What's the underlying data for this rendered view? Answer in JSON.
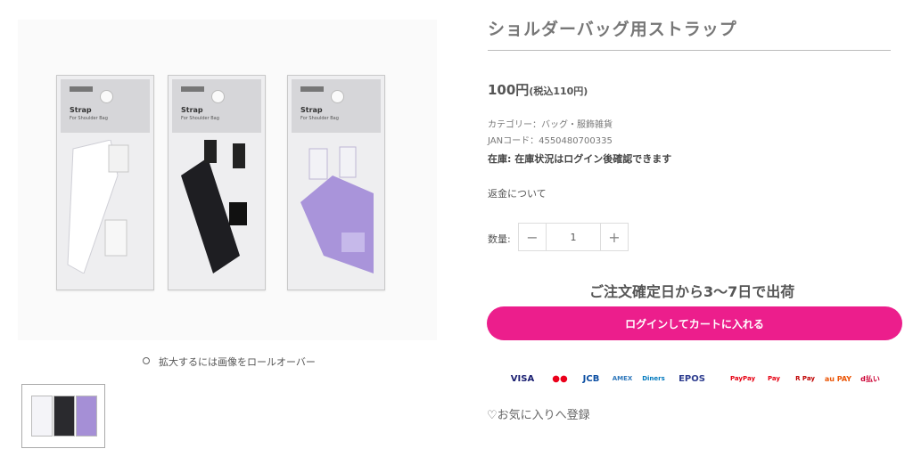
{
  "product": {
    "title": "ショルダーバッグ用ストラップ",
    "price": "100円",
    "price_tax": "(税込110円)",
    "category": "カテゴリー：バッグ・服飾雑貨",
    "jan": "JANコード：4550480700335",
    "stock_label": "在庫:",
    "stock_text": "在庫状況はログイン後確認できます",
    "refund_link": "返金について",
    "qty_label": "数量:",
    "qty_minus": "−",
    "qty_value": "1",
    "qty_plus": "+",
    "shipping_note": "ご注文確定日から3〜7日で出荷",
    "cart_button": "ログインしてカートに入れる",
    "favorite": "お気に入りへ登録"
  },
  "gallery": {
    "zoom_hint": "拡大するには画像をロールオーバー",
    "package_title": "Strap",
    "package_sub": "For Shoulder Bag",
    "variants": [
      {
        "color": "#f4f4f8",
        "strap": "#ffffff",
        "edge": "#cfcfd6"
      },
      {
        "color": "#2a2a2e",
        "strap": "#1e1e22",
        "edge": "#111"
      },
      {
        "color": "#a58fd6",
        "strap": "#a994da",
        "edge": "#7e68b4"
      }
    ]
  },
  "payments": [
    {
      "label": "VISA",
      "color": "#1a1f71"
    },
    {
      "label": "●●",
      "color": "#eb001b"
    },
    {
      "label": "JCB",
      "color": "#0b4ea2"
    },
    {
      "label": "AMEX",
      "color": "#2e77bb"
    },
    {
      "label": "Diners",
      "color": "#0079be"
    },
    {
      "label": "EPOS",
      "color": "#2e3d8f"
    },
    {
      "label": "PayPay",
      "color": "#e60012"
    },
    {
      "label": "Pay",
      "color": "#e60012"
    },
    {
      "label": "R Pay",
      "color": "#bf0000"
    },
    {
      "label": "au PAY",
      "color": "#eb5505"
    },
    {
      "label": "d払い",
      "color": "#cc0033"
    }
  ]
}
